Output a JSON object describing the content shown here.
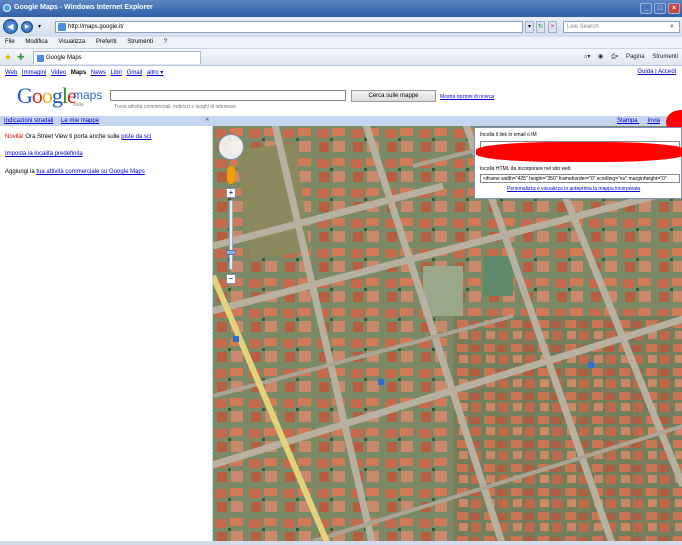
{
  "window": {
    "title": "Google Maps - Windows Internet Explorer"
  },
  "addressbar": {
    "url": "http://maps.google.it/",
    "search_placeholder": "Live Search"
  },
  "menubar": {
    "items": [
      "File",
      "Modifica",
      "Visualizza",
      "Preferiti",
      "Strumenti",
      "?"
    ]
  },
  "tabbar": {
    "tab_label": "Google Maps",
    "commands": [
      "Pagina",
      "Strumenti"
    ]
  },
  "google_links": {
    "items": [
      "Web",
      "Immagini",
      "Video",
      "Maps",
      "News",
      "Libri",
      "Gmail",
      "altro ▾"
    ],
    "right": "Guida | Accedi"
  },
  "logo": {
    "text_g": "G",
    "text_o1": "o",
    "text_o2": "o",
    "text_g2": "g",
    "text_l": "l",
    "text_e": "e",
    "maps": "maps",
    "country": "Italia"
  },
  "searchbox": {
    "hint": "Trova attività commerciali, indirizzi e luoghi di interesse",
    "button": "Cerca sulle mappe",
    "options": "Mostra opzioni di ricerca"
  },
  "leftbar": {
    "directions": "Indicazioni stradali",
    "mymaps": "Le mie mappe",
    "collapse": "«"
  },
  "leftpanel": {
    "news_label": "Novità!",
    "news_text": " Ora Street View ti porta anche sulle ",
    "news_link": "piste da sci",
    "default_location": "Imposta la località predefinita",
    "business_prefix": "Aggiungi la ",
    "business_link": "tua attività commerciale su Google Maps"
  },
  "maplinks": {
    "print": "Stampa",
    "send": "Invia"
  },
  "linkpanel": {
    "email_label": "Incolla il link in email o IM",
    "html_label": "Incolla HTML da incorporare nel sito web",
    "html_code": "<iframe width=\"425\" height=\"350\" frameborder=\"0\" scrolling=\"no\" marginheight=\"0\"",
    "customize": "Personalizza e visualizza in anteprima la mappa incorporata"
  }
}
